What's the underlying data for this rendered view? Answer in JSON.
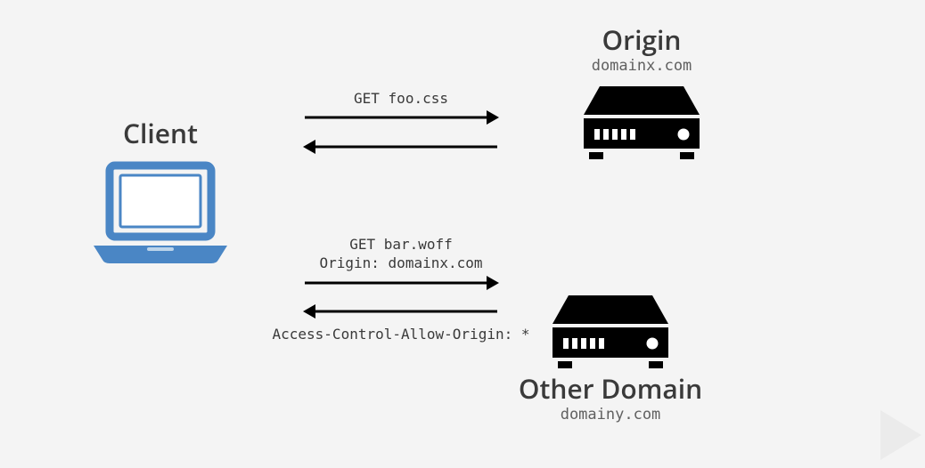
{
  "client": {
    "title": "Client"
  },
  "origin": {
    "title": "Origin",
    "domain": "domainx.com"
  },
  "other": {
    "title": "Other Domain",
    "domain": "domainy.com"
  },
  "req1": {
    "line1": "GET foo.css"
  },
  "req2": {
    "line1": "GET bar.woff",
    "line2": "Origin: domainx.com"
  },
  "resp2": {
    "line1": "Access-Control-Allow-Origin: *"
  },
  "icons": {
    "client": "laptop-icon",
    "server": "server-icon"
  }
}
